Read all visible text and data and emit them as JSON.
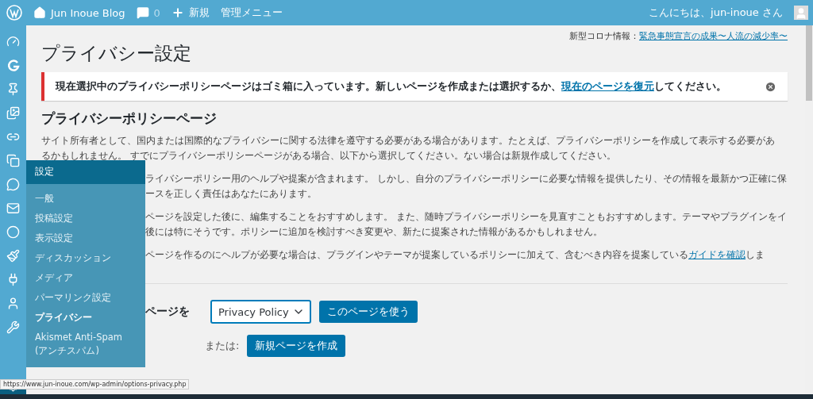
{
  "admin_bar": {
    "site_name": "Jun Inoue Blog",
    "comments_count": "0",
    "new_label": "新規",
    "admin_menu": "管理メニュー",
    "greeting": "こんにちは、jun-inoue さん"
  },
  "news": {
    "label": "新型コロナ情報：",
    "link": "緊急事態宣言の成果〜人流の減少率〜"
  },
  "page_title": "プライバシー設定",
  "notice": {
    "text_before": "現在選択中のプライバシーポリシーページはゴミ箱に入っています。新しいページを作成または選択するか、",
    "link": "現在のページを復元",
    "text_after": "してください。"
  },
  "section_title": "プライバシーポリシーページ",
  "paragraphs": [
    {
      "covered": false,
      "lines": [
        {
          "text": "サイト所有者として、国内または国際的なプライバシーに関する法律を遵守する必要がある場合があります。たとえば、プライバシーポリシーを作成して表示する必要があ"
        },
        {
          "text": "るかもしれません。 すでにプライバシーポリシーページがある場合、以下から選択してください。ない場合は新規作成してください。"
        }
      ]
    },
    {
      "covered": true,
      "lines": [
        {
          "text": "ライバシーポリシー用のヘルプや提案が含まれます。 しかし、自分のプライバシーポリシーに必要な情報を提供したり、その情報を最新かつ正確に保"
        },
        {
          "text": "ースを正しく責任はあなたにあります。"
        }
      ]
    },
    {
      "covered": true,
      "lines": [
        {
          "text": "ページを設定した後に、編集することをおすすめします。 また、随時プライバシーポリシーを見直すこともおすすめします。テーマやプラグインをイ"
        },
        {
          "text": "後には特にそうです。ポリシーに追加を検討すべき変更や、新たに提案された情報があるかもしれません。"
        }
      ]
    },
    {
      "covered": true,
      "lines": [
        {
          "text": "ページを作るのにヘルプが必要な場合は、プラグインやテーマが提案しているポリシーに加えて、含むべき内容を提案している",
          "link": "ガイドを確認",
          "after": "しま"
        }
      ]
    }
  ],
  "form": {
    "label": "ページを",
    "select_value": "Privacy Policy",
    "use_button": "このページを使う",
    "or_label": "または:",
    "create_button": "新規ページを作成"
  },
  "flyout": {
    "header": "設定",
    "items": [
      {
        "label": "一般",
        "selected": false
      },
      {
        "label": "投稿設定",
        "selected": false
      },
      {
        "label": "表示設定",
        "selected": false
      },
      {
        "label": "ディスカッション",
        "selected": false
      },
      {
        "label": "メディア",
        "selected": false
      },
      {
        "label": "パーマリンク設定",
        "selected": false
      },
      {
        "label": "プライバシー",
        "selected": true
      },
      {
        "label": "Akismet Anti-Spam (アンチスパム)",
        "selected": false
      }
    ]
  },
  "status_url": "https://www.jun-inoue.com/wp-admin/options-privacy.php"
}
